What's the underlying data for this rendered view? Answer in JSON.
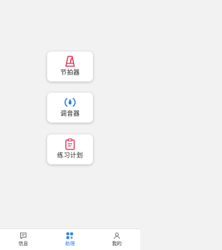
{
  "cards": [
    {
      "label": "节拍器",
      "icon": "metronome-icon",
      "color": "#e53a5b"
    },
    {
      "label": "调音器",
      "icon": "tuner-icon",
      "color": "#2b7de9"
    },
    {
      "label": "练习计划",
      "icon": "clipboard-icon",
      "color": "#e53a5b"
    }
  ],
  "tabs": [
    {
      "label": "信息",
      "icon": "message-icon",
      "active": false
    },
    {
      "label": "助理",
      "icon": "assistant-grid-icon",
      "active": true
    },
    {
      "label": "我的",
      "icon": "profile-icon",
      "active": false
    }
  ],
  "colors": {
    "accent": "#2b7de9",
    "red": "#e53a5b",
    "background": "#f2f2f2"
  }
}
